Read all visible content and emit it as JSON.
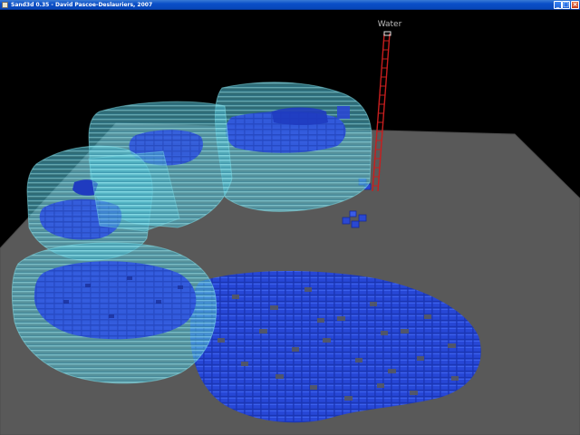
{
  "window": {
    "title": "Sand3d 0.35 - David Pascoe-Deslauriers, 2007",
    "buttons": {
      "minimize_glyph": "_",
      "maximize_glyph": "□",
      "close_glyph": "×"
    }
  },
  "scene": {
    "material_label": "Water",
    "colors": {
      "background": "#000000",
      "ground": "#595959",
      "water": "#1e3fc8",
      "glass": "#5ec7d6",
      "cursor": "#c81e1e"
    }
  }
}
